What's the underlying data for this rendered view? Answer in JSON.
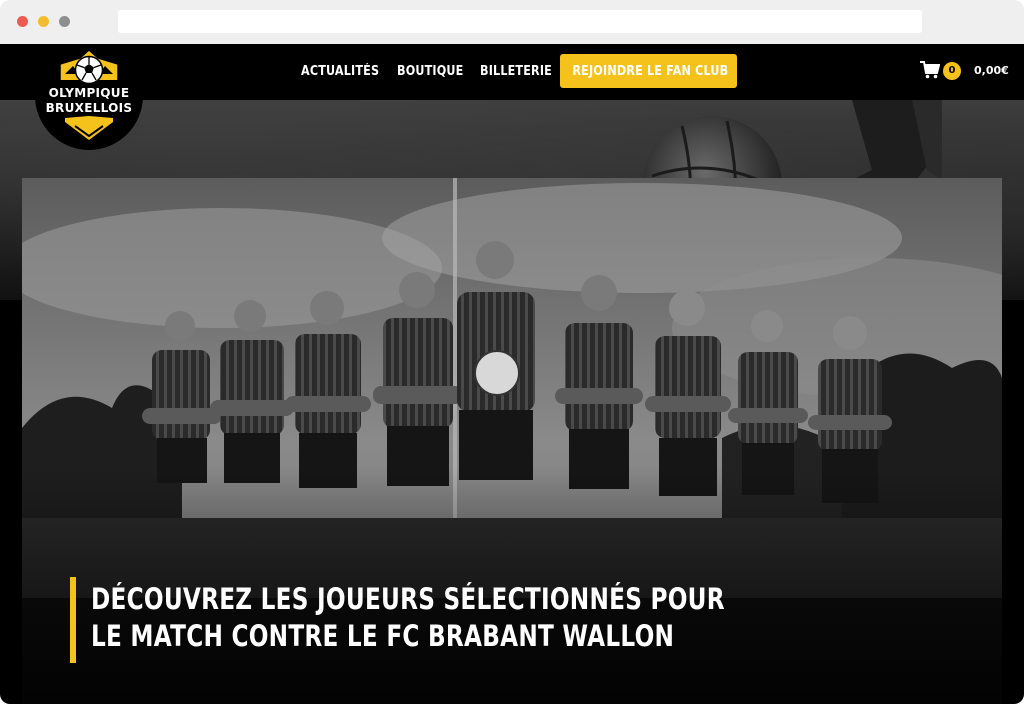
{
  "brand": {
    "name_line1": "OLYMPIQUE",
    "name_line2": "BRUXELLOIS",
    "accent_color": "#f4c21a",
    "icon": "soccer-ball-icon"
  },
  "nav": {
    "items": [
      {
        "label": "ACTUALITÉS"
      },
      {
        "label": "BOUTIQUE"
      },
      {
        "label": "BILLETERIE"
      }
    ],
    "cta_label": "REJOINDRE LE FAN CLUB"
  },
  "cart": {
    "icon": "cart-icon",
    "count": "0",
    "total": "0,00€"
  },
  "hero": {
    "headline_line1": "DÉCOUVREZ LES JOUEURS SÉLECTIONNÉS POUR",
    "headline_line2": "LE MATCH CONTRE LE FC BRABANT WALLON"
  }
}
